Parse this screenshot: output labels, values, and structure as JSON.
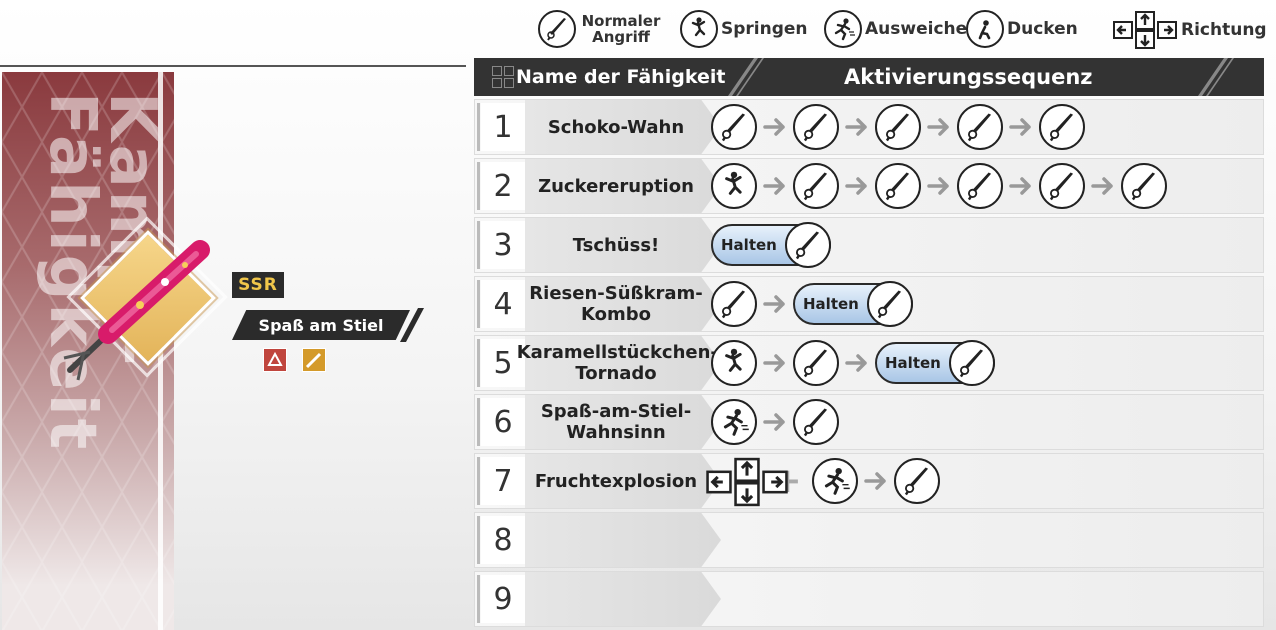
{
  "legend": {
    "attack_label": "Normaler Angriff",
    "jump_label": "Springen",
    "dodge_label": "Ausweichen",
    "crouch_label": "Ducken",
    "direction_label": "Richtung"
  },
  "left": {
    "vertical_title": "Kampf-Fähigkeit",
    "rarity": "SSR",
    "weapon_name": "Spaß am Stiel"
  },
  "table": {
    "col_name": "Name der Fähigkeit",
    "col_sequence": "Aktivierungssequenz",
    "hold_label": "Halten",
    "rows": [
      {
        "num": "1",
        "name": "Schoko-Wahn",
        "seq": [
          "attack",
          "attack",
          "attack",
          "attack",
          "attack"
        ]
      },
      {
        "num": "2",
        "name": "Zuckereruption",
        "seq": [
          "jump",
          "attack",
          "attack",
          "attack",
          "attack",
          "attack"
        ]
      },
      {
        "num": "3",
        "name": "Tschüss!",
        "seq": [
          "hold"
        ]
      },
      {
        "num": "4",
        "name": "Riesen-Süßkram-Kombo",
        "seq": [
          "attack",
          "hold"
        ]
      },
      {
        "num": "5",
        "name": "Karamellstückchen-Tornado",
        "seq": [
          "jump",
          "attack",
          "hold"
        ]
      },
      {
        "num": "6",
        "name": "Spaß-am-Stiel-Wahnsinn",
        "seq": [
          "dodge",
          "attack"
        ]
      },
      {
        "num": "7",
        "name": "Fruchtexplosion",
        "seq": [
          "direction",
          "plus",
          "dodge",
          "attack"
        ]
      },
      {
        "num": "8",
        "name": "",
        "seq": []
      },
      {
        "num": "9",
        "name": "",
        "seq": []
      }
    ]
  }
}
